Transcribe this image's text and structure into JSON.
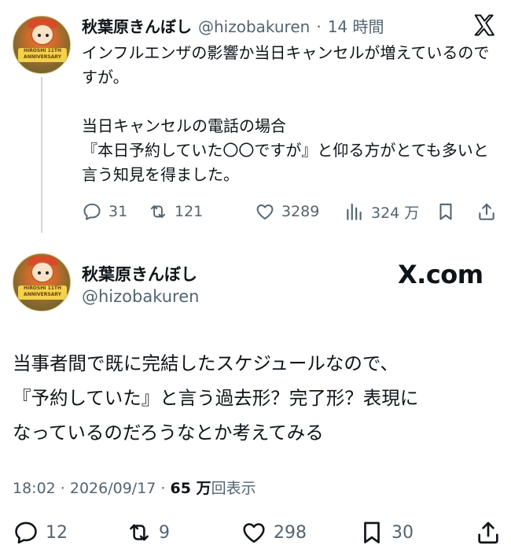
{
  "reply_tweet": {
    "author_name": "秋葉原きんぼし",
    "author_handle": "@hizobakuren",
    "separator": "·",
    "time_ago": "14 時間",
    "paragraphs": [
      "インフルエンザの影響か当日キャンセルが増えているのですが。",
      "当日キャンセルの電話の場合\n『本日予約していた〇〇ですが』と仰る方がとても多いと言う知見を得ました。"
    ],
    "stats": {
      "replies": "31",
      "reposts": "121",
      "likes": "3289",
      "views": "324 万"
    },
    "icons": {
      "platform_logo": "x-logo",
      "reply": "speech-bubble-icon",
      "repost": "repost-arrows-icon",
      "like": "heart-icon",
      "views": "bar-chart-icon",
      "bookmark": "bookmark-icon",
      "share": "share-upload-icon"
    }
  },
  "main_tweet": {
    "author_name": "秋葉原きんぼし",
    "author_handle": "@hizobakuren",
    "site_label": "X.com",
    "body_lines": [
      "当事者間で既に完結したスケジュールなので、",
      "『予約していた』と言う過去形？完了形？表現に",
      "なっているのだろうなとか考えてみる"
    ],
    "timestamp": "18:02 · 2026/09/17 · ",
    "view_count": "65 万",
    "view_suffix": "回表示",
    "stats": {
      "replies": "12",
      "reposts": "9",
      "likes": "298",
      "bookmarks": "30"
    }
  },
  "avatar": {
    "badge_text": "HIROSHI 11TH ANNIVERSARY"
  }
}
